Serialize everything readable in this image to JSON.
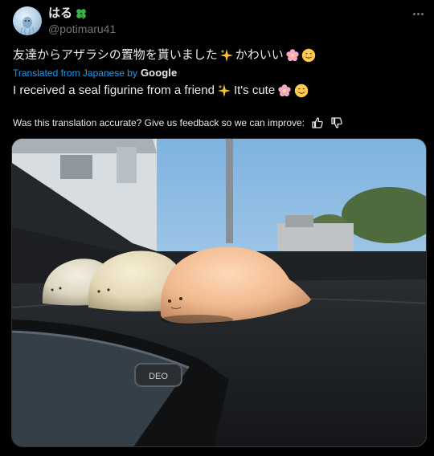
{
  "post": {
    "display_name": "はる",
    "handle": "@potimaru41",
    "original_text_ja": "友達からアザラシの置物を貰いました",
    "original_text_ja_suffix": "かわいい",
    "translated_from": "Translated from Japanese by",
    "translator_brand": "Google",
    "translation_text": "I received a seal figurine from a friend",
    "translation_suffix": "It's cute",
    "feedback_prompt": "Was this translation accurate? Give us feedback so we can improve:",
    "media": {
      "description_icons": [
        "seal-figurine-white",
        "seal-figurine-cream",
        "seal-figurine-orange"
      ],
      "button_text": "DEO"
    }
  },
  "icons": {
    "clover": "four-leaf-clover-icon",
    "sparkles": "sparkles-icon",
    "flower": "cherry-blossom-icon",
    "smile": "smiling-face-icon",
    "more": "more-options-icon",
    "thumbs_up": "thumbs-up-icon",
    "thumbs_down": "thumbs-down-icon"
  },
  "colors": {
    "background": "#000000",
    "text": "#e7e9ea",
    "muted": "#71767b",
    "link": "#1d9bf0"
  }
}
